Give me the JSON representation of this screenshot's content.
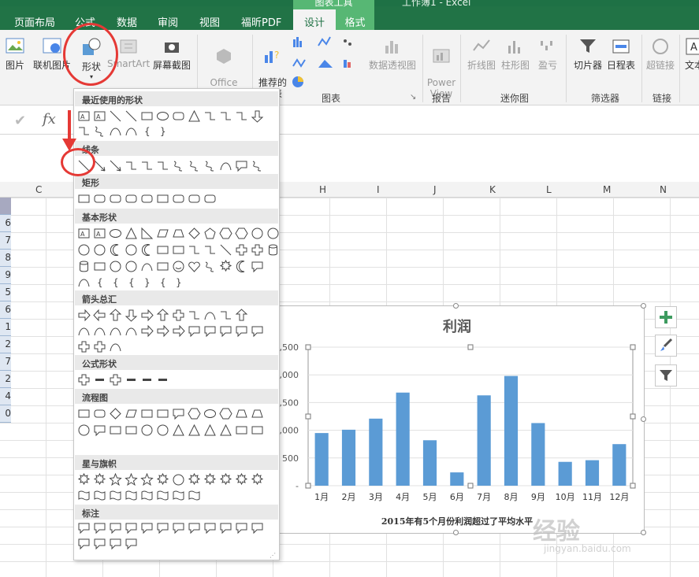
{
  "app": {
    "title_fragment": "工作簿1 - Excel",
    "context_tab_group": "图表工具"
  },
  "tabs": [
    "页面布局",
    "公式",
    "数据",
    "审阅",
    "视图",
    "福昕PDF",
    "设计",
    "格式"
  ],
  "ribbon": {
    "buttons": [
      "图片",
      "联机图片",
      "形状",
      "SmartArt",
      "屏幕截图",
      "Office\n应用程序",
      "推荐的\n图表",
      "数据透视图",
      "Power\nView",
      "折线图",
      "柱形图",
      "盈亏",
      "切片器",
      "日程表",
      "超链接",
      "文本"
    ],
    "groups": [
      "图表",
      "报告",
      "迷你图",
      "筛选器",
      "链接"
    ]
  },
  "formula": {
    "fx": "fx"
  },
  "columns": [
    "C",
    "H",
    "I",
    "J",
    "K",
    "L",
    "M",
    "N"
  ],
  "row_values": [
    "6",
    "7",
    "8",
    "9",
    "5",
    "6",
    "1",
    "2",
    "7",
    "2",
    "4",
    "0"
  ],
  "dropdown": {
    "sections": [
      "最近使用的形状",
      "线条",
      "矩形",
      "基本形状",
      "箭头总汇",
      "公式形状",
      "流程图",
      "星与旗帜",
      "标注"
    ]
  },
  "colors": {
    "accent": "#217346",
    "bar": "#5b9bd5",
    "annotation": "#e53935"
  },
  "chart_data": {
    "type": "bar",
    "title": "利润",
    "subtitle": "2015年有5个月份利润超过了平均水平",
    "categories": [
      "1月",
      "2月",
      "3月",
      "4月",
      "5月",
      "6月",
      "7月",
      "8月",
      "9月",
      "10月",
      "11月",
      "12月"
    ],
    "values": [
      950,
      1010,
      1210,
      1680,
      820,
      240,
      1630,
      1980,
      1130,
      430,
      460,
      750
    ],
    "y_ticks": [
      "2,500",
      "2,000",
      "1,500",
      "1,000",
      "500",
      "-"
    ],
    "ylim": [
      0,
      2500
    ]
  },
  "watermark": {
    "text": "经验",
    "url": "jingyan.baidu.com"
  }
}
